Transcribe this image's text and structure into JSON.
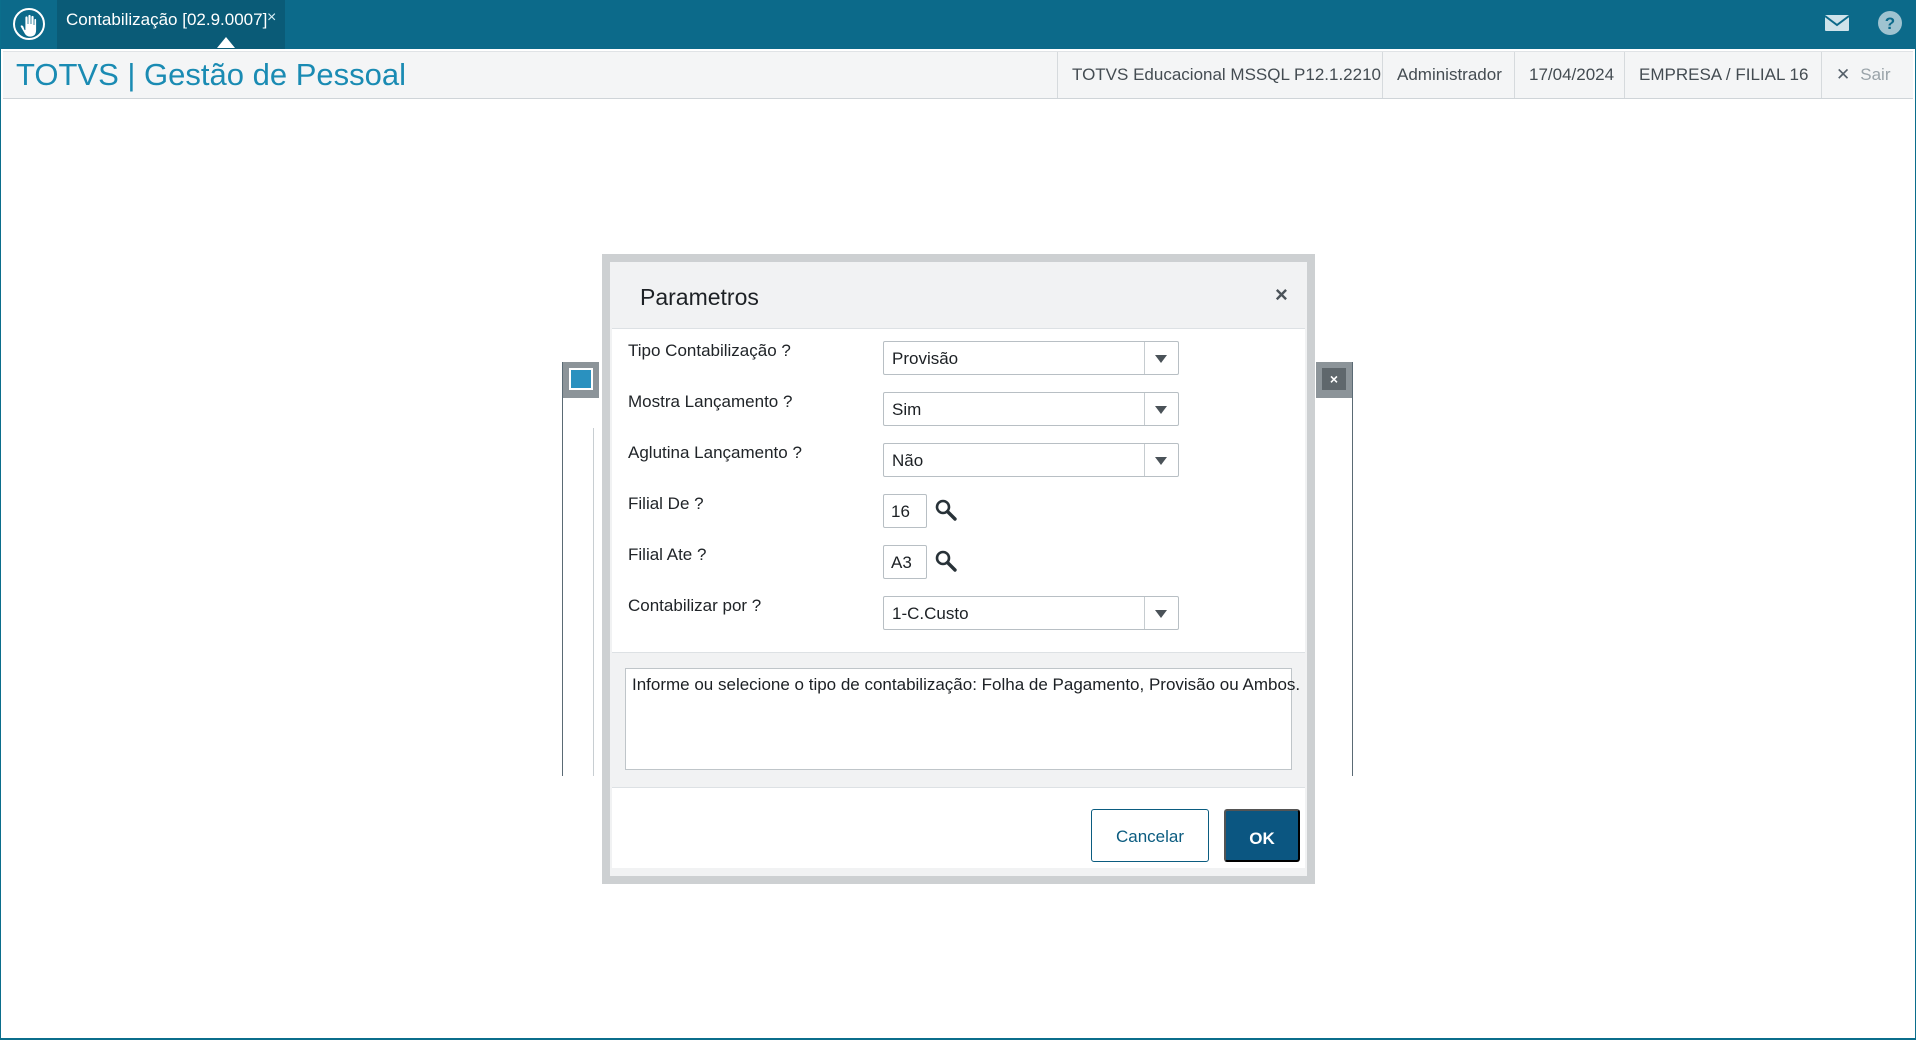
{
  "tab": {
    "label": "Contabilização [02.9.0007]",
    "close": "×"
  },
  "header": {
    "title": "TOTVS | Gestão de Pessoal",
    "environment": "TOTVS Educacional MSSQL P12.1.2210",
    "user": "Administrador",
    "date": "17/04/2024",
    "company": "EMPRESA / FILIAL 16",
    "exit_icon": "✕",
    "exit_label": "Sair"
  },
  "dialog": {
    "title": "Parametros",
    "close": "×",
    "params": {
      "tipo_label": "Tipo Contabilização ?",
      "tipo_value": "Provisão",
      "mostra_label": "Mostra Lançamento ?",
      "mostra_value": "Sim",
      "aglutina_label": "Aglutina Lançamento ?",
      "aglutina_value": "Não",
      "filial_de_label": "Filial De ?",
      "filial_de_value": "16",
      "filial_ate_label": "Filial Ate ?",
      "filial_ate_value": "A3",
      "contabilizar_label": "Contabilizar por ?",
      "contabilizar_value": "1-C.Custo"
    },
    "help_text": "Informe ou selecione o tipo de contabilização: Folha de Pagamento, Provisão ou Ambos.",
    "cancel_label": "Cancelar",
    "ok_label": "OK"
  },
  "background_window": {
    "close": "×"
  },
  "icons": {
    "logo": "touch-hand-icon",
    "mail": "mail-icon",
    "help": "help-icon",
    "lookup": "magnifier-icon",
    "dropdown": "chevron-down-icon"
  },
  "colors": {
    "topbar": "#0c6a8a",
    "tab_active": "#0a5b77",
    "title": "#1a8bb3",
    "primary_button": "#0b5681"
  }
}
